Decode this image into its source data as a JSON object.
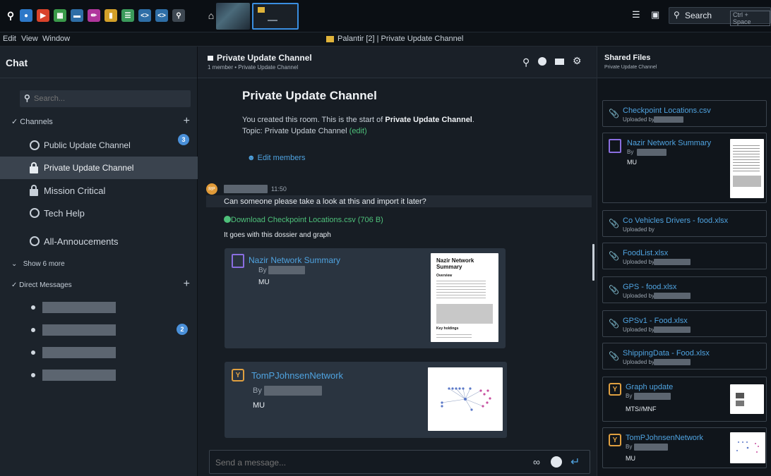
{
  "topbar": {
    "search_label": "Search",
    "search_shortcut": "Ctrl + Space"
  },
  "menubar": {
    "items": [
      "Edit",
      "View",
      "Window"
    ],
    "window_title": "Palantir [2] | Private Update Channel"
  },
  "sidebar": {
    "title": "Chat",
    "search_placeholder": "Search...",
    "channels_header": "Channels",
    "channels": [
      {
        "label": "Public Update Channel",
        "icon": "globe-icon",
        "badge": "3"
      },
      {
        "label": "Private Update Channel",
        "icon": "lock-icon",
        "active": true
      },
      {
        "label": "Mission Critical",
        "icon": "lock-icon"
      },
      {
        "label": "Tech Help",
        "icon": "globe-icon"
      },
      {
        "label": "All-Annoucements",
        "icon": "globe-icon"
      }
    ],
    "show_more": "Show 6 more",
    "dm_header": "Direct Messages",
    "dm_badge": "2"
  },
  "channel": {
    "title": "Private Update Channel",
    "subtitle": "1 member • Private Update Channel",
    "intro_title": "Private Update Channel",
    "intro_line1_prefix": "You created this room. This is the start of ",
    "intro_line1_bold": "Private Update Channel",
    "intro_line1_suffix": ".",
    "intro_topic": "Topic: Private Update Channel",
    "intro_edit": "(edit)",
    "edit_members": "Edit members"
  },
  "message": {
    "avatar_initials": "RP",
    "time": "11:50",
    "text1": "Can someone please take a look at this and import it later?",
    "download_link": "Download Checkpoint Locations.csv (706 B)",
    "text2": "It goes with this dossier and graph"
  },
  "attachments": {
    "dossier": {
      "title": "Nazir Network Summary",
      "by": "By",
      "classification": "MU"
    },
    "graph": {
      "title": "TomPJohnsenNetwork",
      "by": "By",
      "classification": "MU"
    }
  },
  "preview_doc": {
    "title": "Nazir Network Summary",
    "overview": "Overview",
    "key_holdings": "Key holdings"
  },
  "composer": {
    "placeholder": "Send a message..."
  },
  "shared_files": {
    "title": "Shared Files",
    "subtitle": "Private Update Channel",
    "uploaded_by": "Uploaded by",
    "by": "By",
    "files": [
      {
        "name": "Checkpoint Locations.csv"
      },
      {
        "name": "Co Vehicles Drivers - food.xlsx"
      },
      {
        "name": "FoodList.xlsx"
      },
      {
        "name": "GPS - food.xlsx"
      },
      {
        "name": "GPSv1 - Food.xlsx"
      },
      {
        "name": "ShippingData - Food.xlsx"
      }
    ],
    "dossier": {
      "name": "Nazir Network Summary",
      "classification": "MU"
    },
    "graph_update": {
      "name": "Graph update",
      "classification": "MTS//MNF"
    },
    "graph": {
      "name": "TomPJohnsenNetwork",
      "classification": "MU"
    }
  },
  "colors": {
    "accent": "#4fa3e0",
    "green_link": "#4ec07a",
    "badge": "#4a90d9"
  }
}
